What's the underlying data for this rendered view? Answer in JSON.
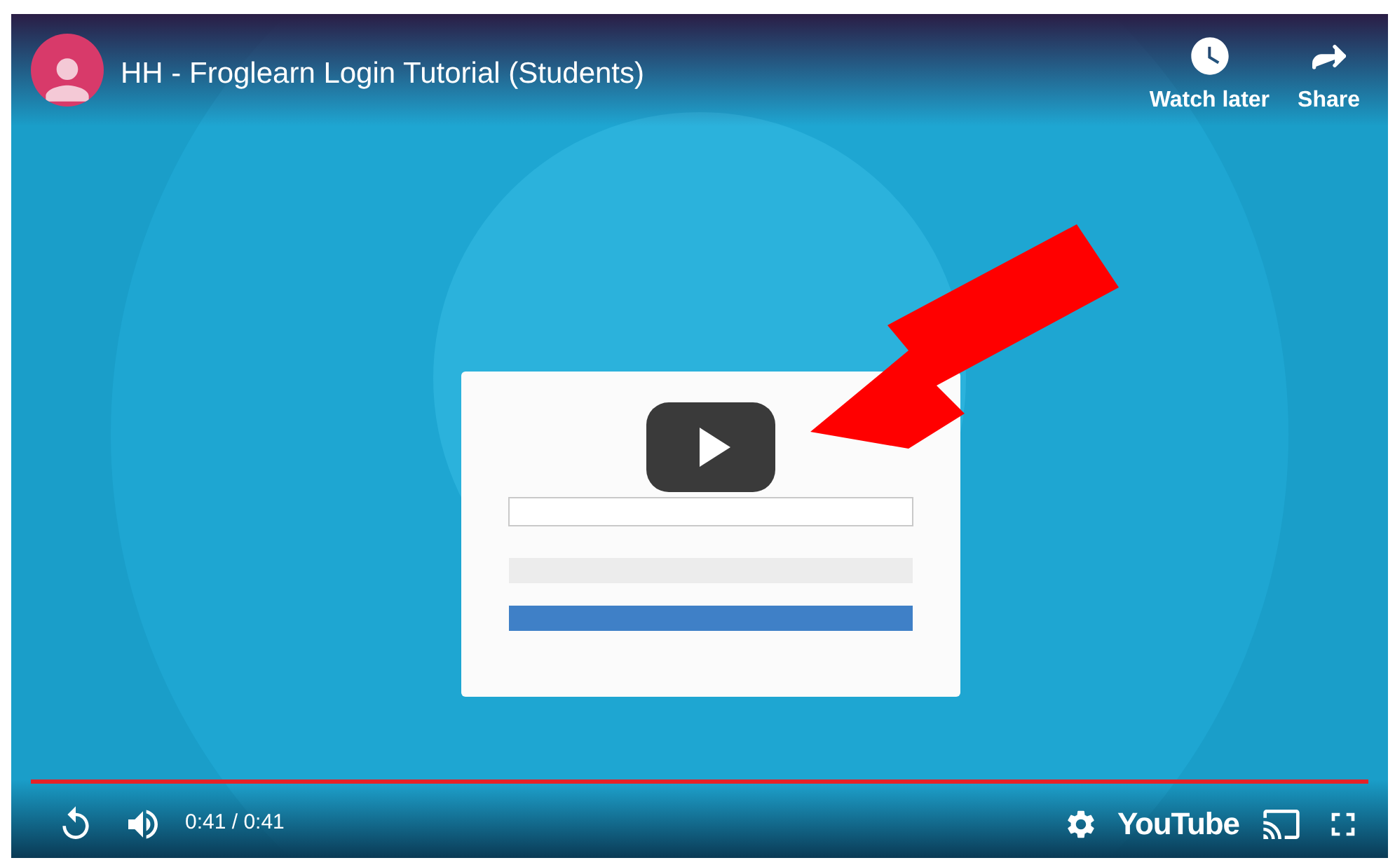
{
  "header": {
    "title": "HH - Froglearn Login Tutorial (Students)",
    "actions": [
      {
        "kind": "watch_later",
        "label": "Watch later"
      },
      {
        "kind": "share",
        "label": "Share"
      }
    ]
  },
  "progress": {
    "level": 1
  },
  "controls": {
    "time": "0:41 / 0:41",
    "logo": "YouTube"
  }
}
